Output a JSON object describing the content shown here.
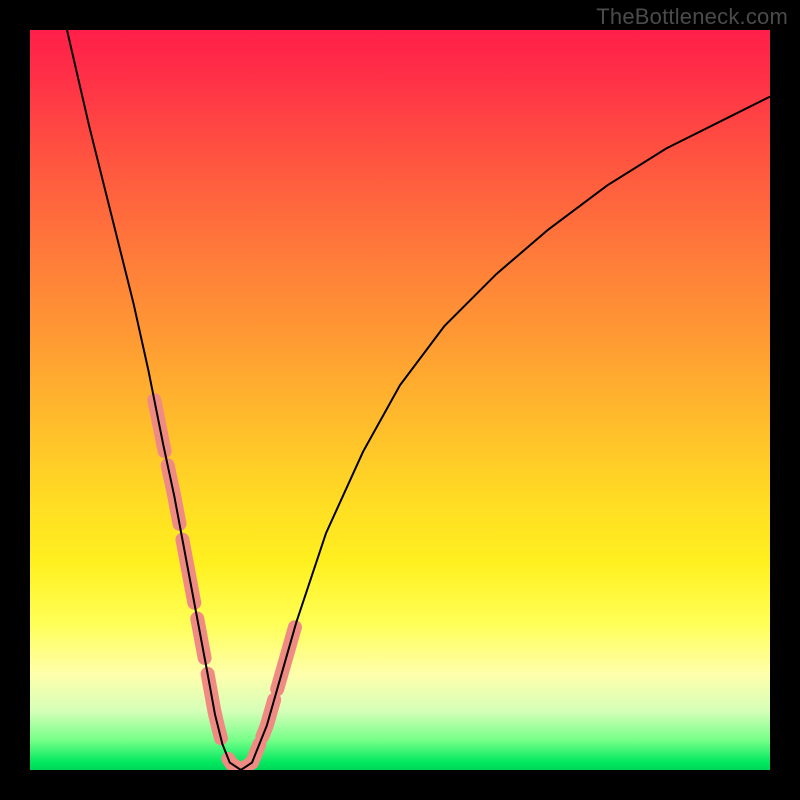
{
  "watermark": "TheBottleneck.com",
  "chart_data": {
    "type": "line",
    "title": "",
    "xlabel": "",
    "ylabel": "",
    "xlim": [
      0,
      100
    ],
    "ylim": [
      0,
      100
    ],
    "x": [
      5,
      8,
      11,
      14,
      16,
      18,
      19.5,
      21,
      22.5,
      24,
      25,
      26,
      27,
      28.5,
      30,
      32,
      34,
      36,
      40,
      45,
      50,
      56,
      63,
      70,
      78,
      86,
      94,
      100
    ],
    "values": [
      100,
      87,
      75,
      63,
      54,
      44,
      37,
      29,
      21,
      13,
      7.5,
      3.5,
      1,
      0,
      1,
      6,
      13,
      20,
      32,
      43,
      52,
      60,
      67,
      73,
      79,
      84,
      88,
      91
    ],
    "marker_segments_x": [
      [
        16.8,
        18.2
      ],
      [
        18.6,
        20.2
      ],
      [
        20.6,
        22.2
      ],
      [
        22.6,
        23.6
      ],
      [
        24.0,
        25.8
      ],
      [
        26.8,
        29.6
      ],
      [
        30.0,
        31.0
      ],
      [
        31.4,
        33.0
      ],
      [
        33.4,
        35.8
      ]
    ],
    "marker_color": "#f08b84",
    "curve_color": "#000000",
    "curve_width": 2
  }
}
